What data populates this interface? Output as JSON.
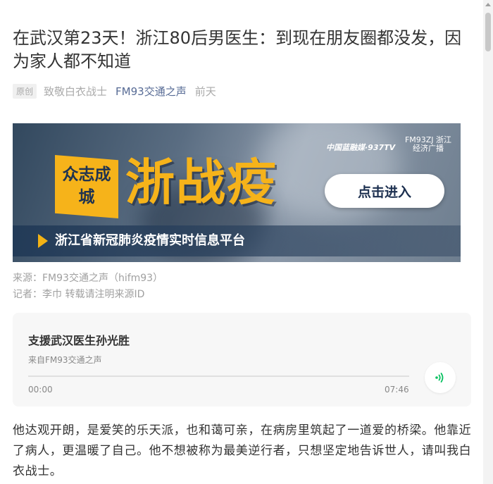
{
  "article": {
    "title": "在武汉第23天！浙江80后男医生：到现在朋友圈都没发，因为家人都不知道",
    "original_badge": "原创",
    "author": "致敬白衣战士",
    "account": "FM93交通之声",
    "time": "前天"
  },
  "banner": {
    "slogan_small": "众志成城",
    "slogan_big": "浙战疫",
    "button_label": "点击进入",
    "platform_text": "浙江省新冠肺炎疫情实时信息平台",
    "logo_text": "中国蓝融媒·937TV",
    "logo2_text": "FM93ZJ 浙江经济广播",
    "accent_color": "#f6b31a"
  },
  "source": {
    "line1": "来源：FM93交通之声（hifm93）",
    "line2": "记者：李巾 转载请注明来源ID"
  },
  "audio": {
    "title": "支援武汉医生孙光胜",
    "from": "来自FM93交通之声",
    "start_time": "00:00",
    "end_time": "07:46",
    "progress": 0,
    "play_icon": "audio-wave-icon",
    "accent_color": "#07c160"
  },
  "body": {
    "paragraph": "他达观开朗，是爱笑的乐天派，也和蔼可亲，在病房里筑起了一道爱的桥梁。他靠近了病人，更温暖了自己。他不想被称为最美逆行者，只想坚定地告诉世人，请叫我白衣战士。"
  }
}
